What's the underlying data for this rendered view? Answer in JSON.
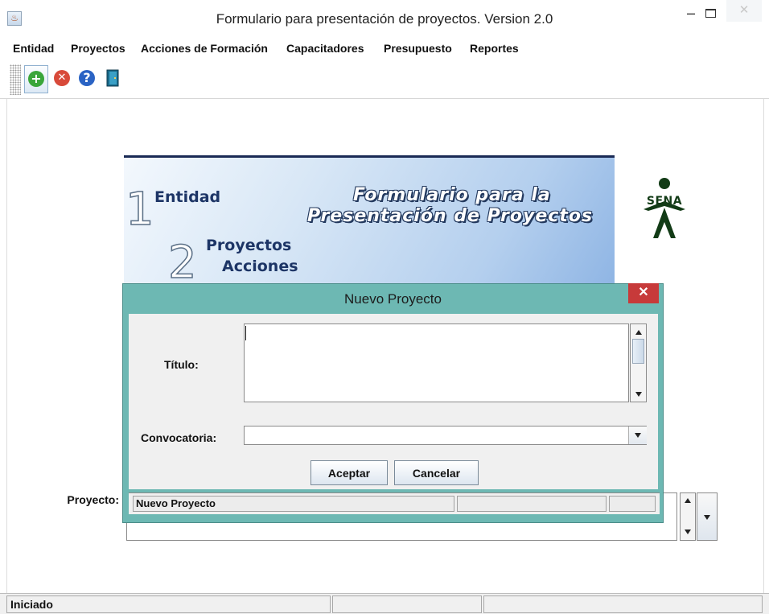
{
  "window": {
    "title": "Formulario para presentación de proyectos. Version 2.0",
    "icon": "java-icon",
    "minimize_symbol": "–",
    "close_symbol": "✕"
  },
  "menu": {
    "items": [
      "Entidad",
      "Proyectos",
      "Acciones de Formación",
      "Capacitadores",
      "Presupuesto",
      "Reportes"
    ]
  },
  "toolbar": {
    "buttons": [
      {
        "icon": "add-icon",
        "symbol": "+",
        "color": "#3aa63a"
      },
      {
        "icon": "delete-icon",
        "symbol": "✕",
        "color": "#d84a3a"
      },
      {
        "icon": "help-icon",
        "symbol": "?",
        "color": "#2a63c4"
      },
      {
        "icon": "exit-door-icon",
        "symbol": "",
        "color": "#1a6a8a"
      }
    ]
  },
  "banner": {
    "step1_num": "1",
    "step1_label": "Entidad",
    "step2_num": "2",
    "step2_label_1": "Proyectos",
    "step2_label_2": "Acciones",
    "title_line1": "Formulario para la",
    "title_line2": "Presentación de Proyectos"
  },
  "logo": {
    "text": "SENA",
    "color": "#123b16"
  },
  "main_form": {
    "proyecto_label": "Proyecto:"
  },
  "dialog": {
    "title": "Nuevo Proyecto",
    "close_symbol": "✕",
    "titulo_label": "Título:",
    "titulo_value": "",
    "convocatoria_label": "Convocatoria:",
    "convocatoria_value": "",
    "accept_label": "Aceptar",
    "cancel_label": "Cancelar",
    "row_cells": [
      "Nuevo Proyecto",
      "",
      ""
    ]
  },
  "statusbar": {
    "status_text": "Iniciado",
    "cells": [
      "",
      ""
    ]
  }
}
